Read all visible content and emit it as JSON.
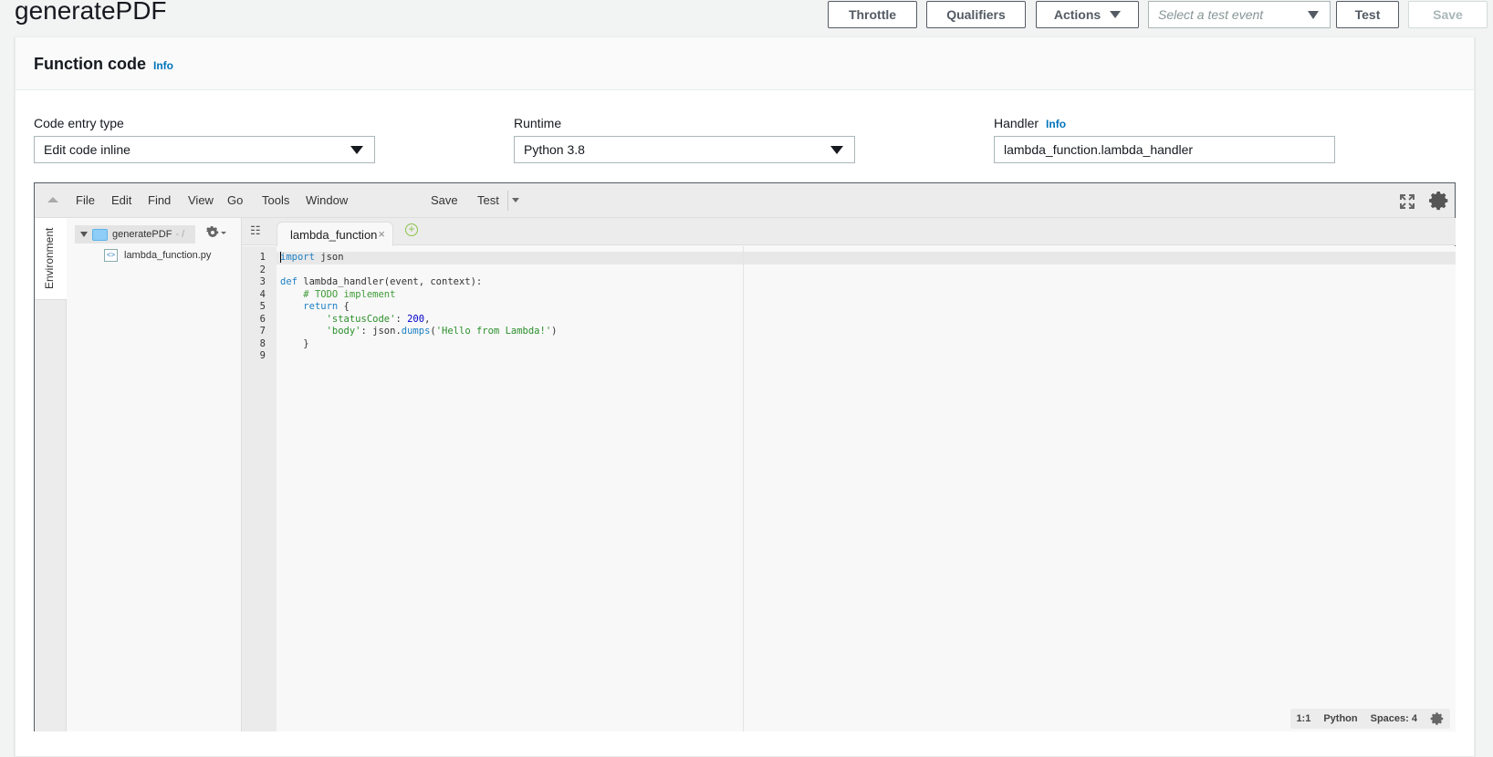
{
  "header": {
    "title": "generatePDF",
    "throttle": "Throttle",
    "qualifiers": "Qualifiers",
    "actions": "Actions",
    "test_event_placeholder": "Select a test event",
    "test": "Test",
    "save": "Save"
  },
  "panel": {
    "title": "Function code",
    "info": "Info",
    "code_entry_label": "Code entry type",
    "code_entry_value": "Edit code inline",
    "runtime_label": "Runtime",
    "runtime_value": "Python 3.8",
    "handler_label": "Handler",
    "handler_info": "Info",
    "handler_value": "lambda_function.lambda_handler"
  },
  "ide": {
    "menu": [
      "File",
      "Edit",
      "Find",
      "View",
      "Go",
      "Tools",
      "Window"
    ],
    "save": "Save",
    "test": "Test",
    "environment_tab": "Environment",
    "tree_root": "generatePDF",
    "tree_root_path": "- /",
    "tree_file": "lambda_function.py",
    "file_icon_text": "<>",
    "tab_name": "lambda_function",
    "tab_close": "×",
    "add_tab": "+",
    "line_numbers": [
      "1",
      "2",
      "3",
      "4",
      "5",
      "6",
      "7",
      "8",
      "9"
    ],
    "code": {
      "l1_kw": "import",
      "l1_rest": " json",
      "l3_kw": "def",
      "l3_rest": " lambda_handler(event, context):",
      "l4_comment": "# TODO implement",
      "l5_kw": "return",
      "l5_rest": " {",
      "l6_str": "'statusCode'",
      "l6_mid": ": ",
      "l6_num": "200",
      "l6_end": ",",
      "l7_str": "'body'",
      "l7_mid": ": json.",
      "l7_fn": "dumps",
      "l7_open": "(",
      "l7_str2": "'Hello from Lambda!'",
      "l7_close": ")",
      "l8": "    }"
    },
    "status": {
      "position": "1:1",
      "language": "Python",
      "spaces": "Spaces: 4"
    }
  },
  "icons": {
    "fullscreen": "fullscreen-icon",
    "settings": "gear-icon"
  },
  "colors": {
    "keyword": "#1b7fc4",
    "comment": "#3f9a38",
    "string": "#2c8f2c",
    "number": "#0000cd",
    "link": "#0073bb"
  }
}
